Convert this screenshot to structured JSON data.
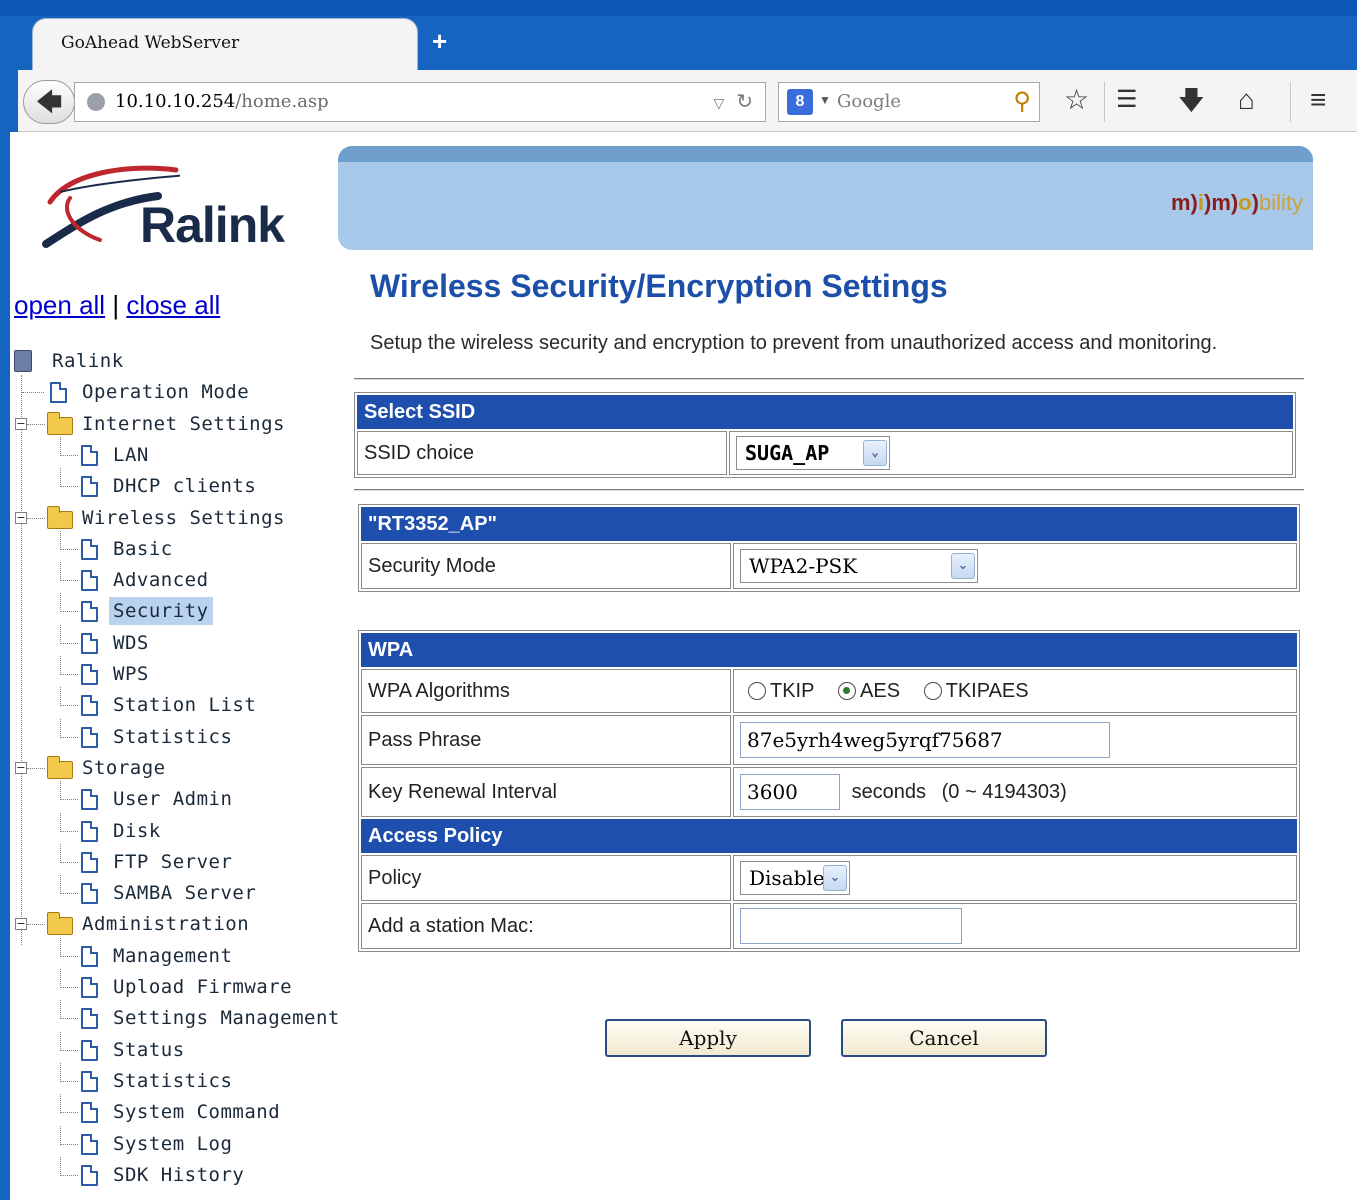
{
  "browser": {
    "tab_title": "GoAhead WebServer",
    "new_tab": "+",
    "url_host": "10.10.10.254",
    "url_path": "/home.asp",
    "search_engine_badge": "8",
    "search_placeholder": "Google",
    "icons": [
      "back-arrow",
      "globe",
      "reload",
      "search-magnifier",
      "star",
      "reading-list",
      "download-arrow",
      "home",
      "hamburger-menu"
    ]
  },
  "sidebar": {
    "open_all": "open all",
    "separator": "|",
    "close_all": "close all",
    "tree": {
      "root": "Ralink",
      "operation_mode": "Operation Mode",
      "internet_settings": {
        "label": "Internet Settings",
        "items": [
          "LAN",
          "DHCP clients"
        ]
      },
      "wireless_settings": {
        "label": "Wireless Settings",
        "items": [
          "Basic",
          "Advanced",
          "Security",
          "WDS",
          "WPS",
          "Station List",
          "Statistics"
        ],
        "selected": "Security"
      },
      "storage": {
        "label": "Storage",
        "items": [
          "User Admin",
          "Disk",
          "FTP Server",
          "SAMBA Server"
        ]
      },
      "administration": {
        "label": "Administration",
        "items": [
          "Management",
          "Upload Firmware",
          "Settings Management",
          "Status",
          "Statistics",
          "System Command",
          "System Log",
          "SDK History"
        ]
      }
    }
  },
  "logo": {
    "text": "Ralink"
  },
  "banner": {
    "brand_a": "m",
    "brand_b": "i",
    "brand_c": "m",
    "brand_d": "o",
    "brand_tail": "bility"
  },
  "main": {
    "title": "Wireless Security/Encryption Settings",
    "description": "Setup the wireless security and encryption to prevent from unauthorized access and monitoring.",
    "select_ssid": {
      "header": "Select SSID",
      "label": "SSID choice",
      "value": "SUGA_AP"
    },
    "ap": {
      "header": "\"RT3352_AP\"",
      "security_mode_label": "Security Mode",
      "security_mode_value": "WPA2-PSK"
    },
    "wpa": {
      "header": "WPA",
      "algorithms_label": "WPA Algorithms",
      "algorithms": [
        {
          "label": "TKIP",
          "checked": false
        },
        {
          "label": "AES",
          "checked": true
        },
        {
          "label": "TKIPAES",
          "checked": false
        }
      ],
      "pass_phrase_label": "Pass Phrase",
      "pass_phrase_value": "87e5yrh4weg5yrqf75687",
      "key_renewal_label": "Key Renewal Interval",
      "key_renewal_value": "3600",
      "key_renewal_unit": "seconds",
      "key_renewal_range": "(0 ~ 4194303)"
    },
    "access_policy": {
      "header": "Access Policy",
      "policy_label": "Policy",
      "policy_value": "Disable",
      "add_mac_label": "Add a station Mac:",
      "add_mac_value": ""
    },
    "buttons": {
      "apply": "Apply",
      "cancel": "Cancel"
    }
  }
}
